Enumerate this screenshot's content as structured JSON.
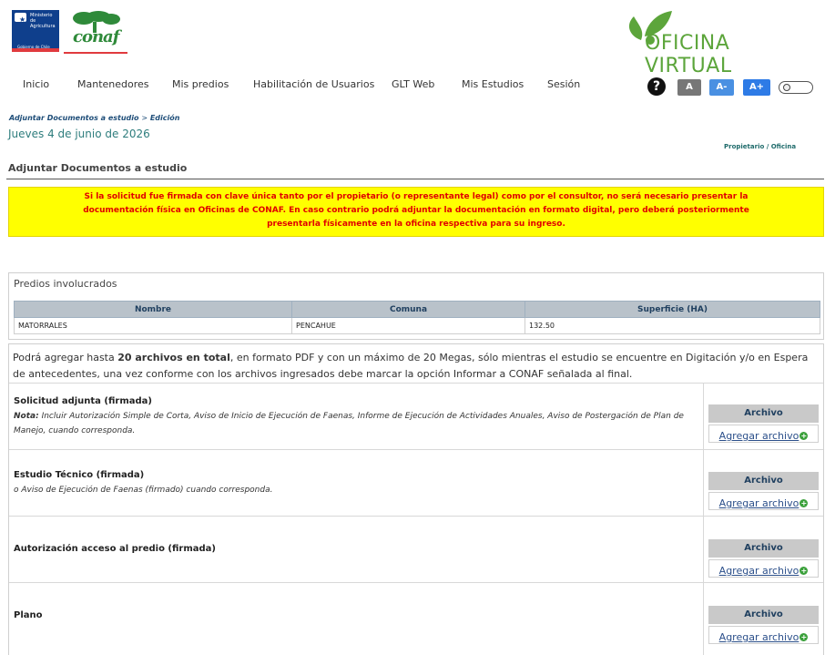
{
  "header": {
    "gob_logo_text": "Ministerio de Agricultura",
    "gob_logo_sub": "Gobierno de Chile",
    "conaf_logo_text": "conaf",
    "brand_text": "OFICINA VIRTUAL"
  },
  "nav": {
    "items": [
      {
        "label": "Inicio"
      },
      {
        "label": "Mantenedores"
      },
      {
        "label": "Mis predios"
      },
      {
        "label": "Habilitación de Usuarios"
      },
      {
        "label": "GLT Web"
      },
      {
        "label": "Mis Estudios"
      },
      {
        "label": "Sesión"
      }
    ],
    "help_label": "?",
    "font_buttons": [
      {
        "label": "A",
        "color": "#777777"
      },
      {
        "label": "A-",
        "color": "#4a90e2"
      },
      {
        "label": "A+",
        "color": "#2e7be6"
      }
    ]
  },
  "breadcrumb": {
    "first": "Adjuntar Documentos a estudio",
    "separator": ">",
    "second": "Edición"
  },
  "date": "Jueves 4 de junio de 2026",
  "role": "Propietario / Oficina",
  "page_title": "Adjuntar Documentos a estudio",
  "notice": {
    "line1": "Si la solicitud fue firmada con clave única tanto por el propietario (o representante legal) como por el consultor, no será necesario presentar la",
    "line2": "documentación física en Oficinas de CONAF. En caso contrario podrá adjuntar la documentación en formato digital, pero deberá posteriormente",
    "line3": "presentarla físicamente en la oficina respectiva para su ingreso."
  },
  "predios": {
    "title": "Predios involucrados",
    "columns": [
      "Nombre",
      "Comuna",
      "Superficie (HA)"
    ],
    "rows": [
      [
        "MATORRALES",
        "PENCAHUE",
        "132.50"
      ]
    ]
  },
  "files": {
    "intro_pre": "Podrá agregar hasta ",
    "intro_bold": "20 archivos en total",
    "intro_post": ", en formato PDF y con un máximo de 20 Megas, sólo mientras el estudio se encuentre en Digitación y/o en Espera de antecedentes, una vez conforme con los archivos ingresados debe marcar la opción Informar a CONAF señalada al final.",
    "archivo_label": "Archivo",
    "agregar_label": "Agregar archivo",
    "items": [
      {
        "title": "Solicitud adjunta (firmada)",
        "note_label": "Nota:",
        "note": " Incluir Autorización Simple de Corta, Aviso de Inicio de Ejecución de Faenas, Informe de Ejecución de Actividades Anuales, Aviso de Postergación de Plan de Manejo, cuando corresponda."
      },
      {
        "title": "Estudio Técnico (firmada)",
        "note_label": "",
        "note": "o Aviso de Ejecución de Faenas (firmado) cuando corresponda."
      },
      {
        "title": "Autorización acceso al predio (firmada)",
        "note_label": "",
        "note": ""
      },
      {
        "title": "Plano",
        "note_label": "",
        "note": ""
      }
    ]
  },
  "colors": {
    "notice_bg": "#ffff00",
    "notice_text": "#e00000",
    "brand_green": "#5ca53b",
    "link": "#2b4f8a"
  }
}
